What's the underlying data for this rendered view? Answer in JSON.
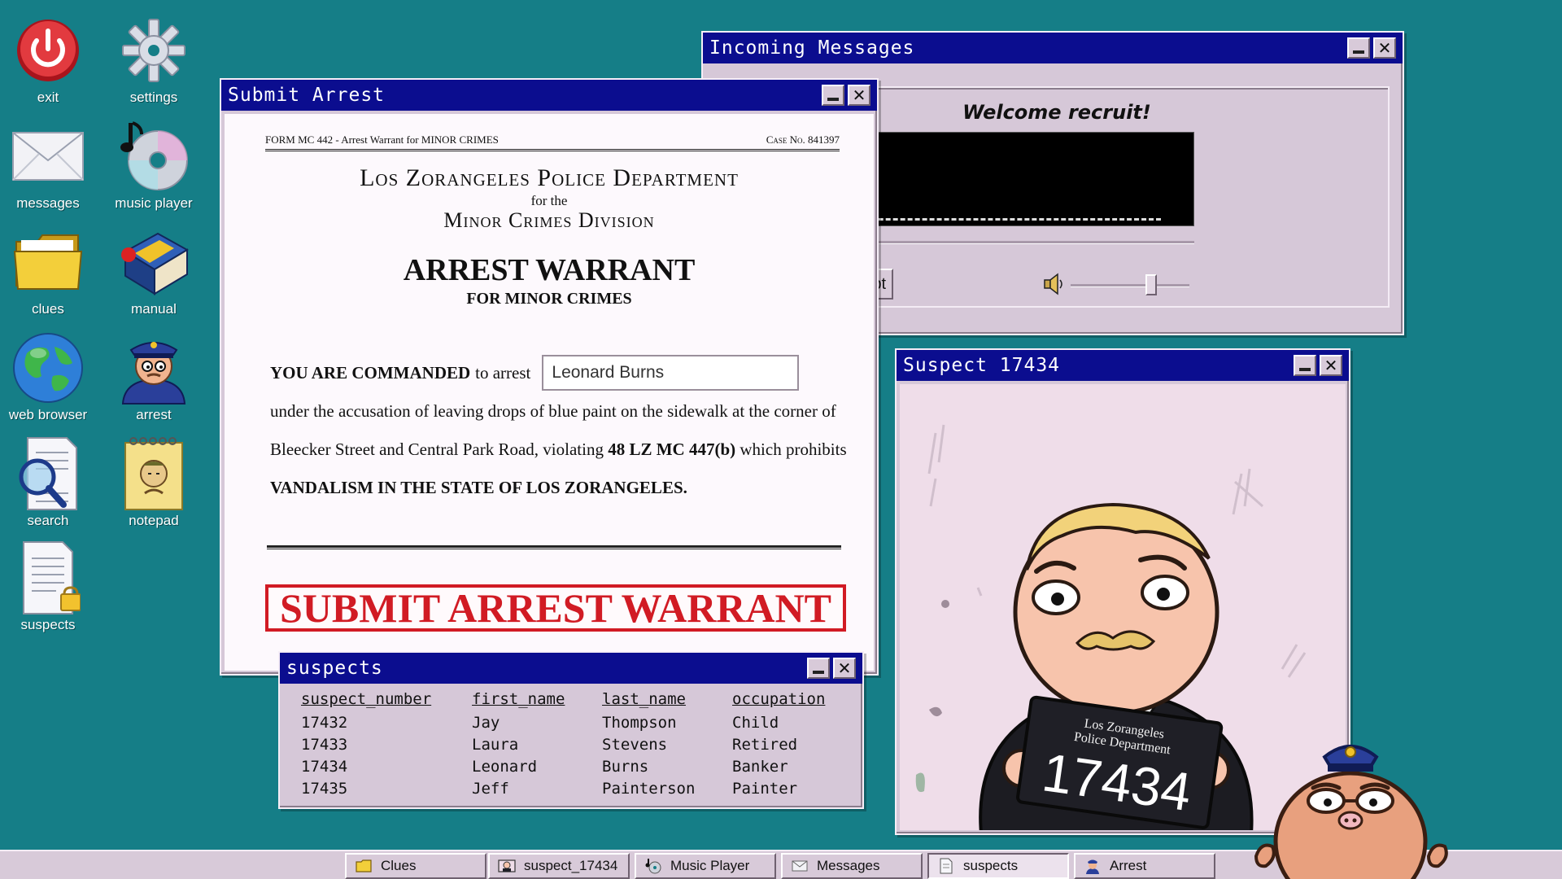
{
  "desktop": {
    "icons": [
      {
        "label": "exit",
        "icon": "power-icon"
      },
      {
        "label": "settings",
        "icon": "gear-icon"
      },
      {
        "label": "messages",
        "icon": "envelope-icon"
      },
      {
        "label": "music player",
        "icon": "cd-music-icon"
      },
      {
        "label": "clues",
        "icon": "folder-icon"
      },
      {
        "label": "manual",
        "icon": "book-icon"
      },
      {
        "label": "web browser",
        "icon": "globe-icon"
      },
      {
        "label": "arrest",
        "icon": "police-officer-icon"
      },
      {
        "label": "search",
        "icon": "magnifier-document-icon"
      },
      {
        "label": "notepad",
        "icon": "notepad-icon"
      },
      {
        "label": "suspects",
        "icon": "locked-document-icon"
      }
    ]
  },
  "arrest_window": {
    "title": "Submit Arrest",
    "form_code": "FORM MC 442 - Arrest Warrant for MINOR CRIMES",
    "case_label": "Case No. 841397",
    "dept_line1": "Los Zorangeles Police Department",
    "dept_line2": "for the",
    "dept_line3": "Minor Crimes Division",
    "heading": "ARREST WARRANT",
    "subheading": "FOR MINOR CRIMES",
    "command_bold": "YOU ARE COMMANDED",
    "command_rest": "to arrest",
    "suspect_name_value": "Leonard Burns",
    "accusation_1": "under the accusation of leaving drops of blue paint on the sidewalk at the corner of Bleecker Street and Central Park Road, violating",
    "statute": "48 LZ MC 447(b)",
    "accusation_2": "which prohibits",
    "crime": "VANDALISM IN THE STATE OF LOS ZORANGELES.",
    "submit_label": "SUBMIT ARREST WARRANT"
  },
  "messages_window": {
    "title": "Incoming Messages",
    "greeting": "Welcome recruit!",
    "transcript_label": "Transcript",
    "progress": 0,
    "volume": 0.7
  },
  "suspect_window": {
    "title": "Suspect 17434",
    "placard_line1": "Los Zorangeles",
    "placard_line2": "Police Department",
    "placard_number": "17434"
  },
  "suspects_window": {
    "title": "suspects",
    "columns": [
      "suspect_number",
      "first_name",
      "last_name",
      "occupation"
    ],
    "rows": [
      [
        "17432",
        "Jay",
        "Thompson",
        "Child"
      ],
      [
        "17433",
        "Laura",
        "Stevens",
        "Retired"
      ],
      [
        "17434",
        "Leonard",
        "Burns",
        "Banker"
      ],
      [
        "17435",
        "Jeff",
        "Painterson",
        "Painter"
      ]
    ]
  },
  "taskbar": {
    "items": [
      {
        "label": "Clues",
        "icon": "folder-icon"
      },
      {
        "label": "suspect_17434",
        "icon": "mugshot-icon"
      },
      {
        "label": "Music Player",
        "icon": "cd-music-icon"
      },
      {
        "label": "Messages",
        "icon": "envelope-icon"
      },
      {
        "label": "suspects",
        "icon": "document-icon"
      },
      {
        "label": "Arrest",
        "icon": "police-officer-icon"
      }
    ]
  }
}
